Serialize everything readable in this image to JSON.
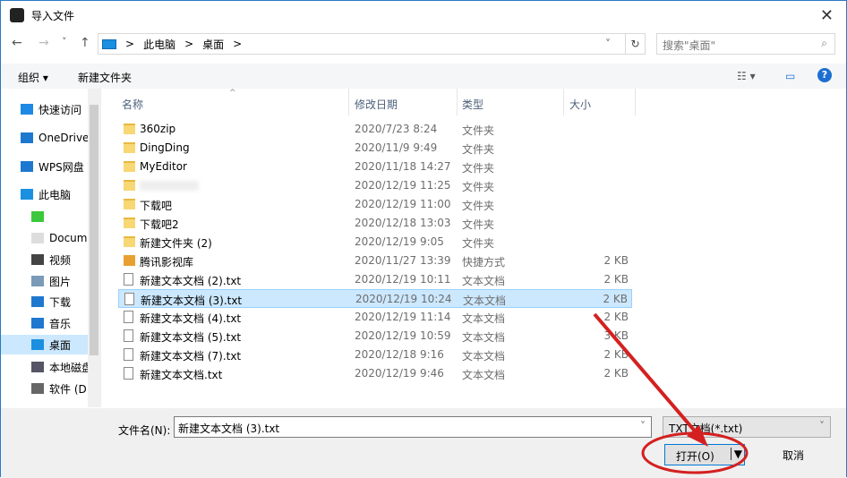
{
  "window": {
    "title": "导入文件",
    "close": "✕"
  },
  "nav": {
    "back": "←",
    "forward": "→",
    "recent": "˅",
    "up": "↑",
    "path": [
      "此电脑",
      "桌面"
    ],
    "sep": ">",
    "addr_dropdown": "˅",
    "refresh": "↻",
    "search_placeholder": "搜索\"桌面\"",
    "search_icon": "⌕"
  },
  "toolbar": {
    "organize": "组织 ▾",
    "new_folder": "新建文件夹",
    "view": "☷ ▾",
    "pane": "▭",
    "help": "?"
  },
  "sidebar": {
    "items": [
      "快速访问",
      "OneDrive",
      "WPS网盘",
      "此电脑",
      "",
      "Docum",
      "视频",
      "图片",
      "下载",
      "音乐",
      "桌面",
      "本地磁盘",
      "软件 (D"
    ]
  },
  "columns": {
    "name": "名称",
    "date": "修改日期",
    "type": "类型",
    "size": "大小"
  },
  "files": [
    {
      "name": "360zip",
      "date": "2020/7/23 8:24",
      "type": "文件夹",
      "size": "",
      "kind": "folder"
    },
    {
      "name": "DingDing",
      "date": "2020/11/9 9:49",
      "type": "文件夹",
      "size": "",
      "kind": "folder"
    },
    {
      "name": "MyEditor",
      "date": "2020/11/18 14:27",
      "type": "文件夹",
      "size": "",
      "kind": "folder"
    },
    {
      "name": "",
      "date": "2020/12/19 11:25",
      "type": "文件夹",
      "size": "",
      "kind": "folder"
    },
    {
      "name": "下载吧",
      "date": "2020/12/19 11:00",
      "type": "文件夹",
      "size": "",
      "kind": "folder"
    },
    {
      "name": "下载吧2",
      "date": "2020/12/18 13:03",
      "type": "文件夹",
      "size": "",
      "kind": "folder"
    },
    {
      "name": "新建文件夹 (2)",
      "date": "2020/12/19 9:05",
      "type": "文件夹",
      "size": "",
      "kind": "folder"
    },
    {
      "name": "腾讯影视库",
      "date": "2020/11/27 13:39",
      "type": "快捷方式",
      "size": "2 KB",
      "kind": "lnk"
    },
    {
      "name": "新建文本文档 (2).txt",
      "date": "2020/12/19 10:11",
      "type": "文本文档",
      "size": "2 KB",
      "kind": "doc"
    },
    {
      "name": "新建文本文档 (3).txt",
      "date": "2020/12/19 10:24",
      "type": "文本文档",
      "size": "2 KB",
      "kind": "doc"
    },
    {
      "name": "新建文本文档 (4).txt",
      "date": "2020/12/19 11:14",
      "type": "文本文档",
      "size": "2 KB",
      "kind": "doc"
    },
    {
      "name": "新建文本文档 (5).txt",
      "date": "2020/12/19 10:59",
      "type": "文本文档",
      "size": "3 KB",
      "kind": "doc"
    },
    {
      "name": "新建文本文档 (7).txt",
      "date": "2020/12/18 9:16",
      "type": "文本文档",
      "size": "2 KB",
      "kind": "doc"
    },
    {
      "name": "新建文本文档.txt",
      "date": "2020/12/19 9:46",
      "type": "文本文档",
      "size": "2 KB",
      "kind": "doc"
    }
  ],
  "selected_index": 9,
  "bottom": {
    "filename_label": "文件名(N):",
    "filename_value": "新建文本文档 (3).txt",
    "filter": "TXT文档(*.txt)",
    "open": "打开(O)",
    "open_arrow": "▼",
    "cancel": "取消",
    "dropdown": "˅"
  }
}
